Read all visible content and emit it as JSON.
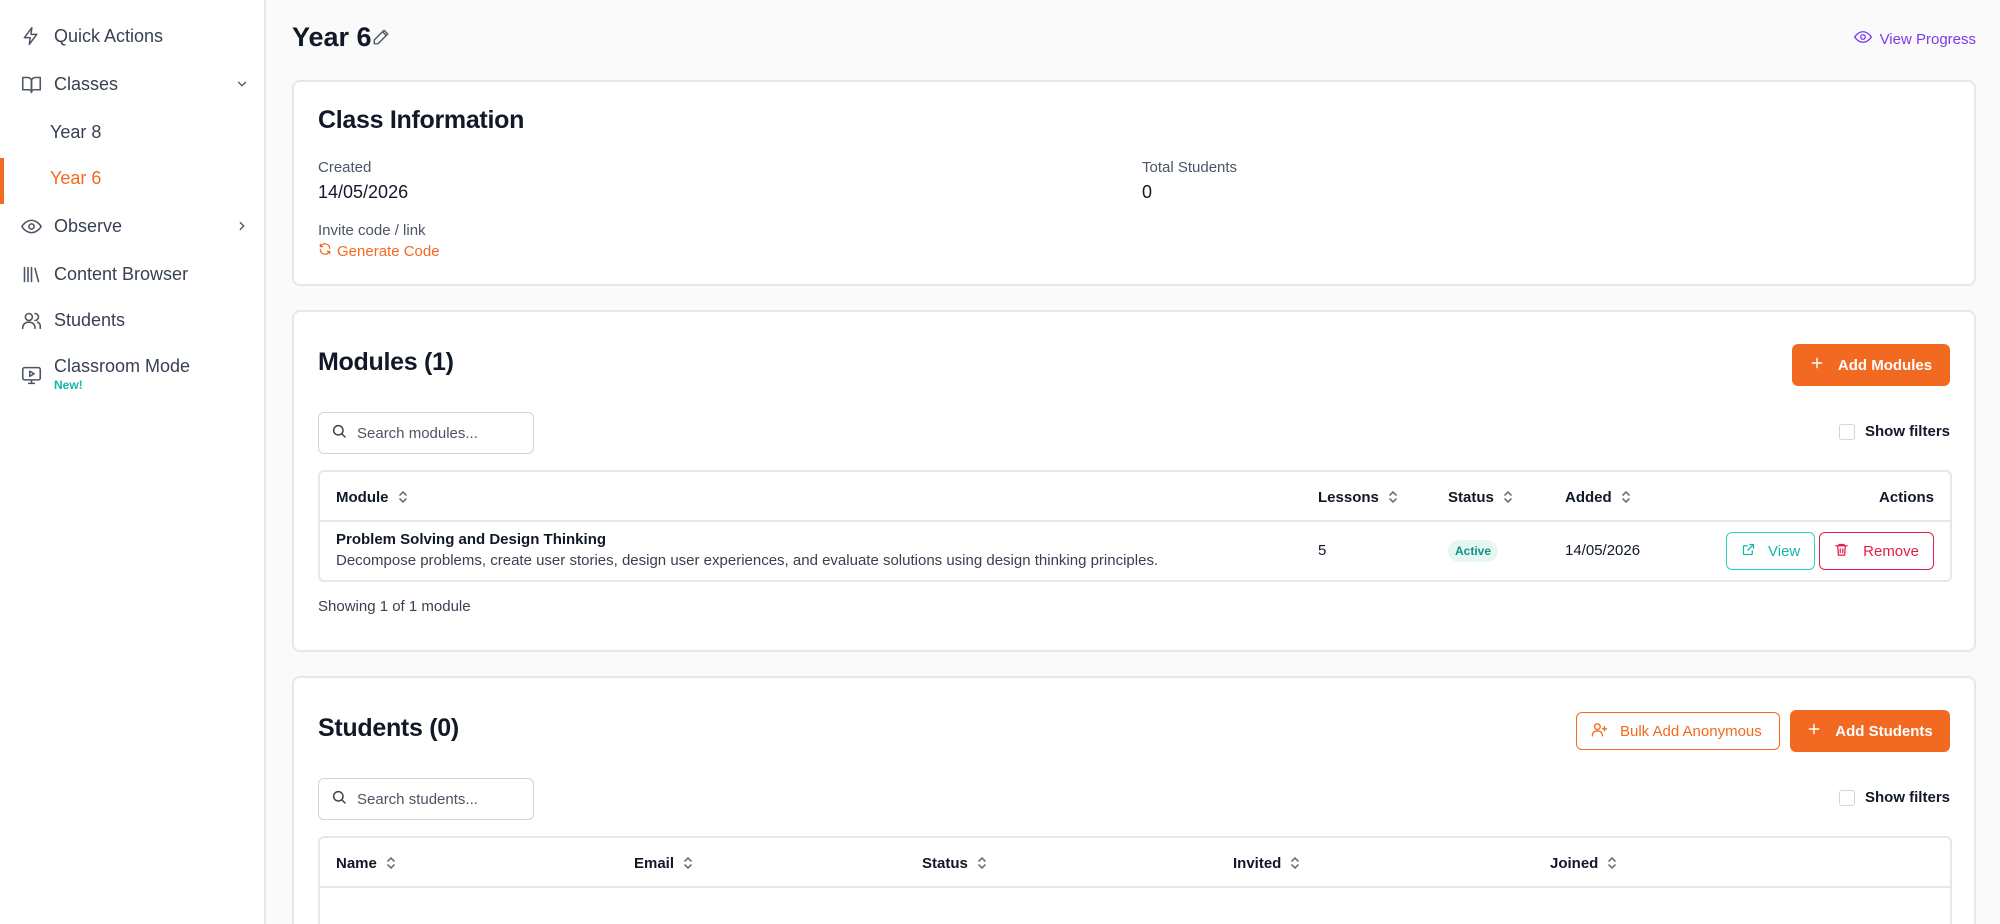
{
  "sidebar": {
    "items": [
      {
        "label": "Quick Actions",
        "icon": "lightning-icon"
      },
      {
        "label": "Classes",
        "icon": "book-icon"
      },
      {
        "label": "Observe",
        "icon": "eye-icon"
      },
      {
        "label": "Content Browser",
        "icon": "library-icon"
      },
      {
        "label": "Students",
        "icon": "users-icon"
      },
      {
        "label": "Classroom Mode",
        "icon": "presentation-icon",
        "badge": "New!"
      }
    ],
    "classes": [
      "Year 8",
      "Year 6"
    ],
    "active_class": "Year 6"
  },
  "header": {
    "title": "Year 6",
    "view_progress": "View Progress"
  },
  "class_info": {
    "heading": "Class Information",
    "created_label": "Created",
    "created_value": "14/05/2026",
    "total_students_label": "Total Students",
    "total_students_value": "0",
    "invite_label": "Invite code / link",
    "generate_code": "Generate Code"
  },
  "modules": {
    "heading": "Modules (1)",
    "add_button": "Add Modules",
    "search_placeholder": "Search modules...",
    "show_filters": "Show filters",
    "columns": [
      "Module",
      "Lessons",
      "Status",
      "Added",
      "Actions"
    ],
    "rows": [
      {
        "title": "Problem Solving and Design Thinking",
        "description": "Decompose problems, create user stories, design user experiences, and evaluate solutions using design thinking principles.",
        "lessons": "5",
        "status": "Active",
        "added": "14/05/2026",
        "view": "View",
        "remove": "Remove"
      }
    ],
    "footer": "Showing 1 of 1 module"
  },
  "students": {
    "heading": "Students (0)",
    "bulk_button": "Bulk Add Anonymous",
    "add_button": "Add Students",
    "search_placeholder": "Search students...",
    "show_filters": "Show filters",
    "columns": [
      "Name",
      "Email",
      "Status",
      "Invited",
      "Joined"
    ]
  },
  "colors": {
    "accent": "#f26a21",
    "teal": "#14b8a6",
    "danger": "#e11d48",
    "link_purple": "#7c3aed"
  }
}
